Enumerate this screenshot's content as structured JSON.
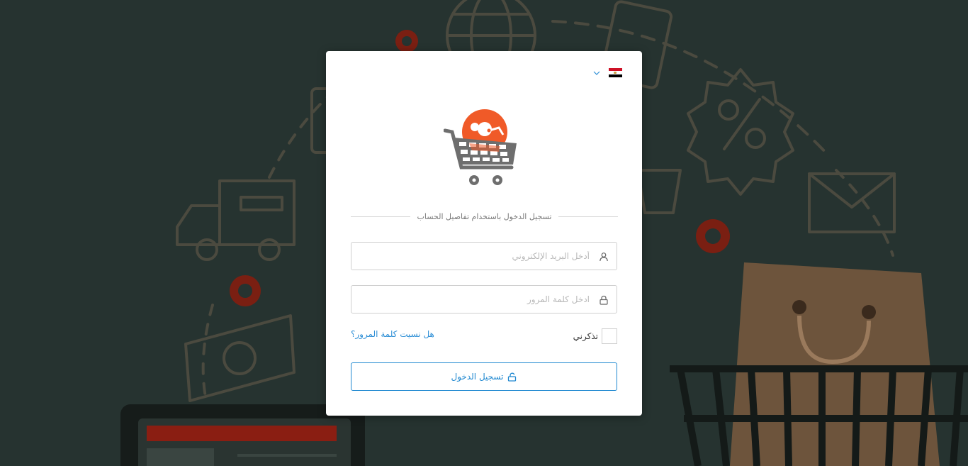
{
  "language": {
    "current_flag": "flag-syria",
    "toggle_icon": "chevron-down-icon"
  },
  "logo": {
    "name": "cart-logo"
  },
  "login": {
    "heading": "تسجيل الدخول باستخدام تفاصيل الحساب",
    "email_placeholder": "أدخل البريد الإلكتروني",
    "email_value": "",
    "password_placeholder": "ادخل كلمة المرور",
    "password_value": "",
    "remember_label": "تذكرني",
    "remember_checked": false,
    "forgot_link": "هل نسيت كلمة المرور؟",
    "submit_label": "تسجيل الدخول"
  },
  "icons": {
    "email": "user-icon",
    "password": "lock-icon",
    "submit": "unlock-icon"
  },
  "colors": {
    "accent": "#1f88d0",
    "logo_orange": "#f05a28",
    "background": "#263330"
  }
}
